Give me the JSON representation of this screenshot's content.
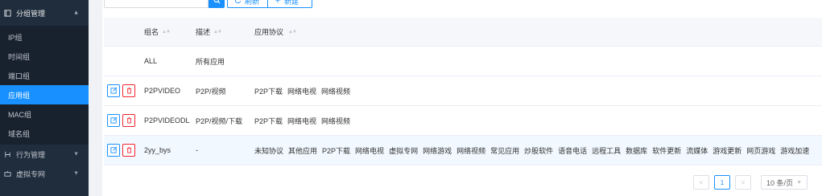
{
  "sidebar": {
    "group_main": {
      "label": "分组管理",
      "icon": "book-icon"
    },
    "items": [
      {
        "label": "IP组"
      },
      {
        "label": "时间组"
      },
      {
        "label": "端口组"
      },
      {
        "label": "应用组"
      },
      {
        "label": "MAC组"
      },
      {
        "label": "域名组"
      }
    ],
    "group_behavior": {
      "label": "行为管理",
      "icon": "branch-icon"
    },
    "group_vpn": {
      "label": "虚拟专网",
      "icon": "vpn-icon"
    }
  },
  "toolbar": {
    "search_placeholder": "",
    "refresh_label": "刷新",
    "new_label": "新建"
  },
  "table": {
    "columns": [
      "组名",
      "描述",
      "应用协议"
    ],
    "rows": [
      {
        "name": "ALL",
        "desc": "所有应用",
        "protocols": [],
        "editable": false
      },
      {
        "name": "P2PVIDEO",
        "desc": "P2P/视频",
        "protocols": [
          "P2P下载",
          "网络电视",
          "网络视频"
        ],
        "editable": true
      },
      {
        "name": "P2PVIDEODL",
        "desc": "P2P/视频/下载",
        "protocols": [
          "P2P下载",
          "网络电视",
          "网络视频"
        ],
        "editable": true
      },
      {
        "name": "2yy_bys",
        "desc": "-",
        "protocols": [
          "未知协议",
          "其他应用",
          "P2P下载",
          "网络电视",
          "虚拟专网",
          "网络游戏",
          "网络视频",
          "常见应用",
          "炒股软件",
          "语音电话",
          "远程工具",
          "数据库",
          "软件更新",
          "流媒体",
          "游戏更新",
          "网页游戏",
          "游戏加速"
        ],
        "editable": true
      }
    ]
  },
  "pagination": {
    "current_page": "1",
    "page_size_label": "10 条/页"
  },
  "colors": {
    "sidebar_bg": "#1f2d3d",
    "accent": "#1890ff",
    "danger": "#f5222d"
  }
}
